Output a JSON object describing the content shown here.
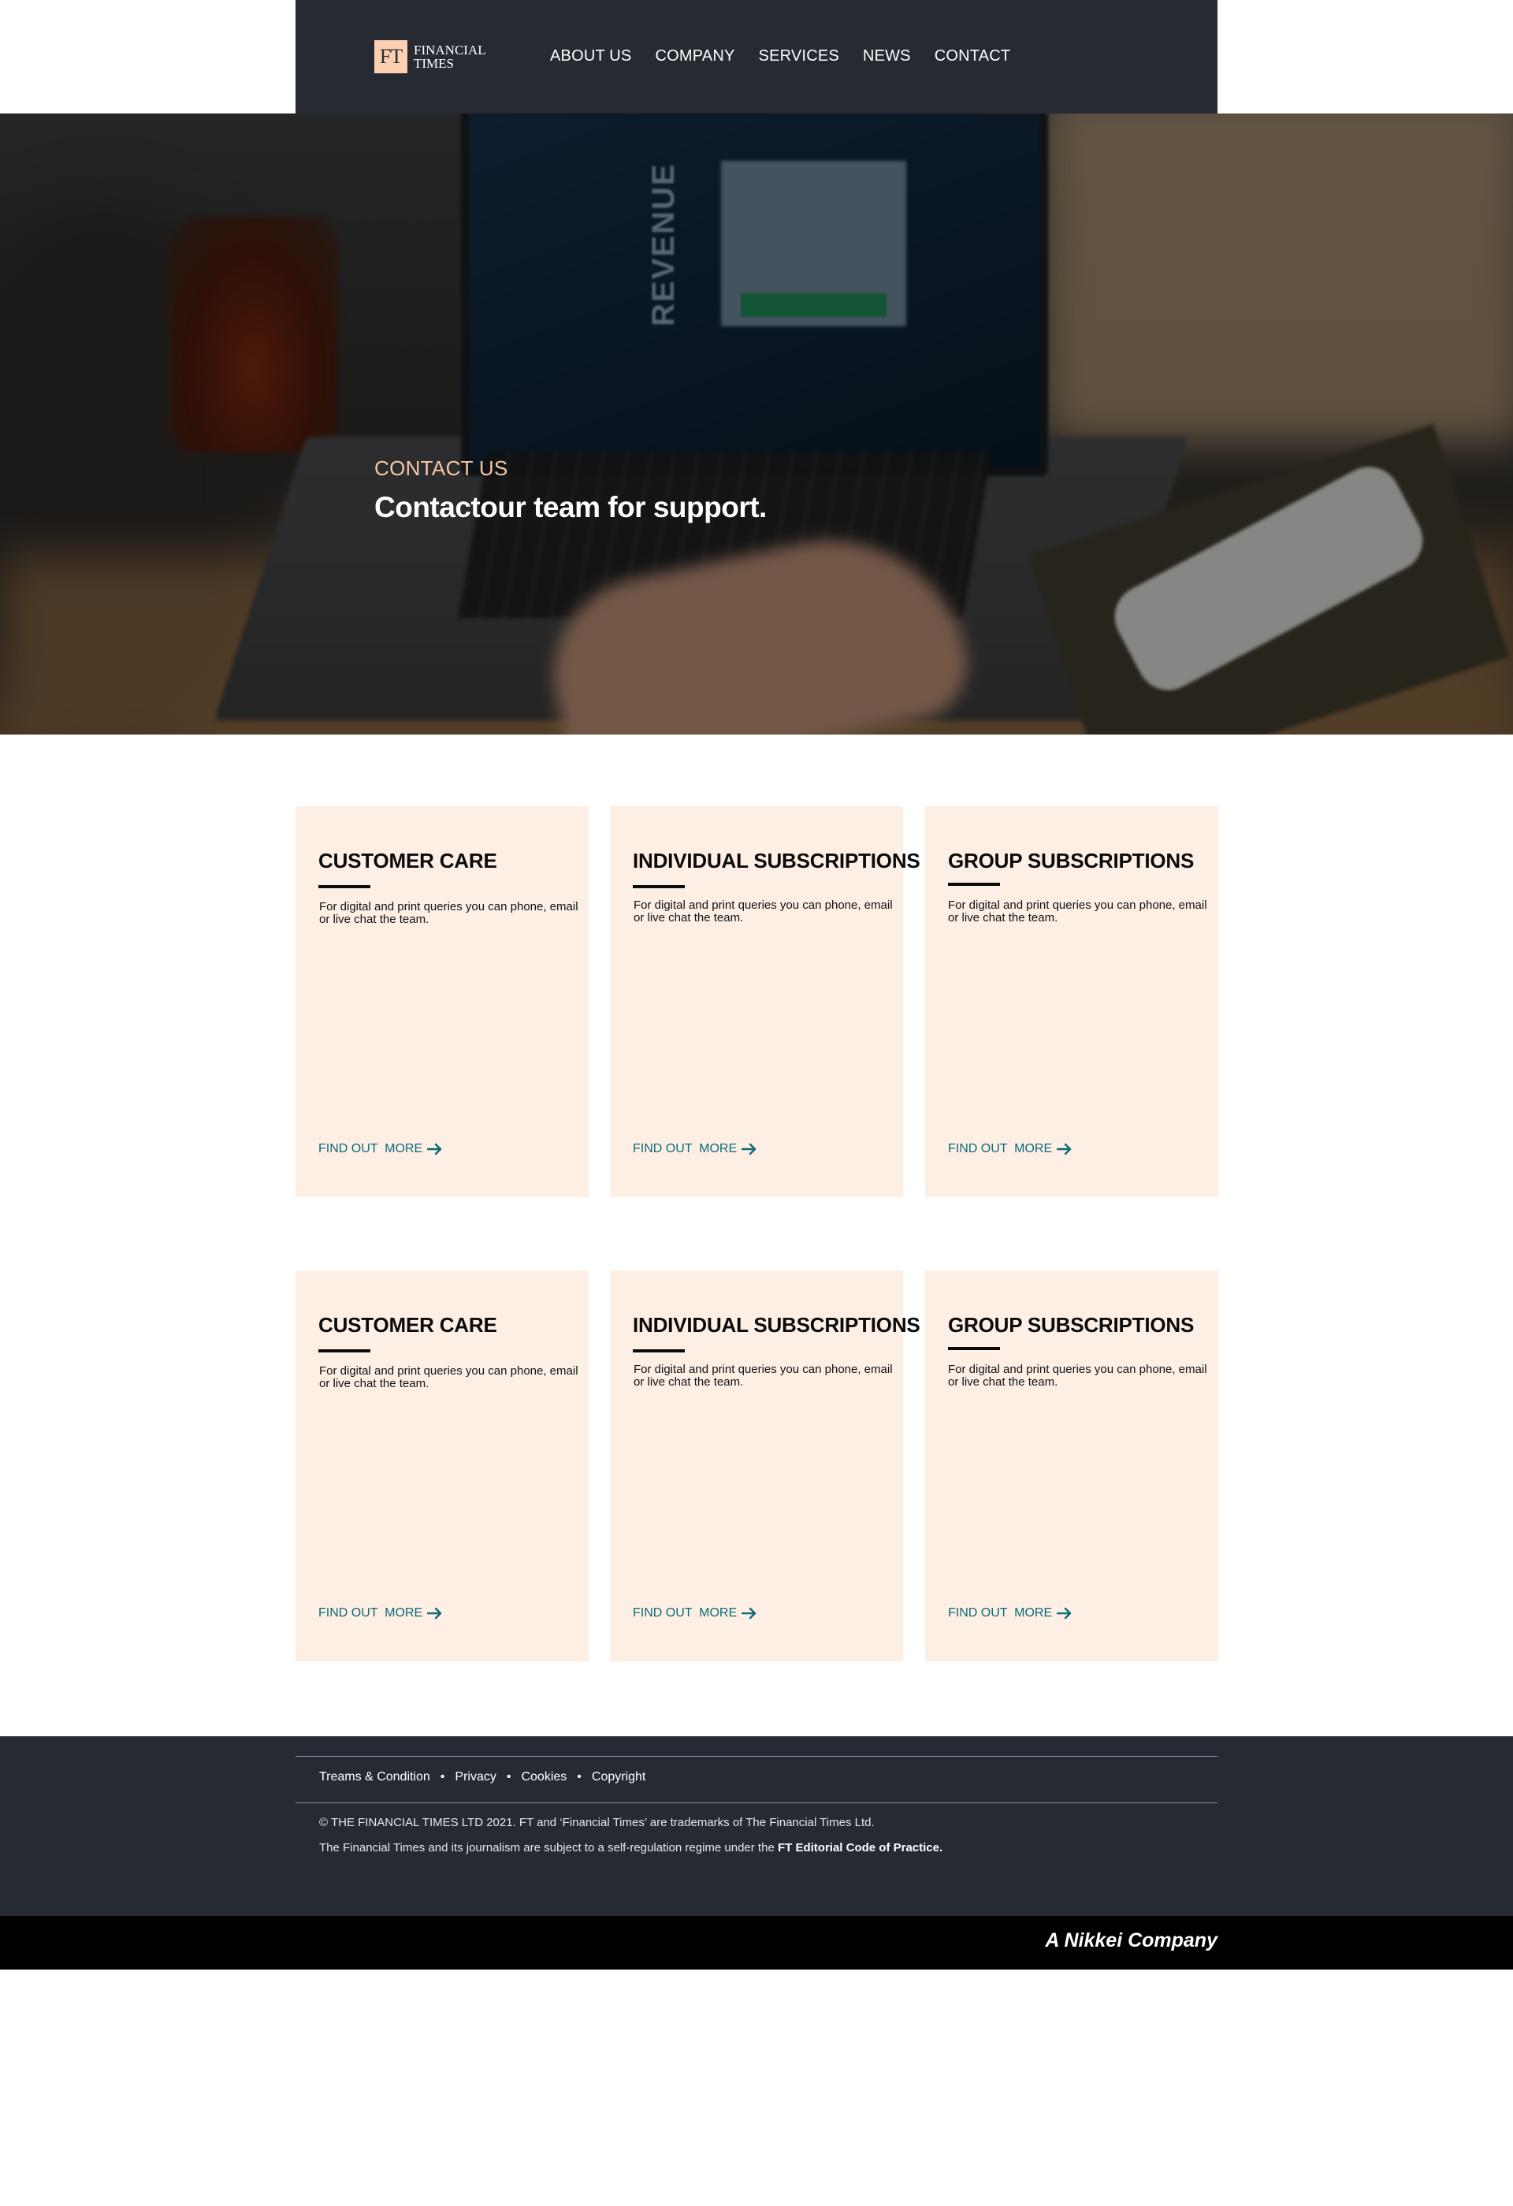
{
  "brand": {
    "logo_mark": "FT",
    "logo_line1": "FINANCIAL",
    "logo_line2": "TIMES"
  },
  "nav": {
    "items": [
      "ABOUT US",
      "COMPANY",
      "SERVICES",
      "NEWS",
      "CONTACT"
    ]
  },
  "hero": {
    "kicker": "CONTACT US",
    "title": "Contactour team for support.",
    "image_text": "REVENUE"
  },
  "cards": [
    {
      "title": "CUSTOMER CARE",
      "body": "For digital and print queries you can phone, email or live chat the team.",
      "link": "FIND OUT  MORE"
    },
    {
      "title": "INDIVIDUAL SUBSCRIPTIONS",
      "body": "For digital and print queries you can phone, email or live chat the team.",
      "link": "FIND OUT  MORE"
    },
    {
      "title": "GROUP SUBSCRIPTIONS",
      "body": "For digital and print queries you can phone, email or live chat the team.",
      "link": "FIND OUT  MORE"
    },
    {
      "title": "CUSTOMER CARE",
      "body": "For digital and print queries you can phone, email or live chat the team.",
      "link": "FIND OUT  MORE"
    },
    {
      "title": "INDIVIDUAL SUBSCRIPTIONS",
      "body": "For digital and print queries you can phone, email or live chat the team.",
      "link": "FIND OUT  MORE"
    },
    {
      "title": "GROUP SUBSCRIPTIONS",
      "body": "For digital and print queries you can phone, email or live chat the team.",
      "link": "FIND OUT  MORE"
    }
  ],
  "footer": {
    "links": [
      "Treams & Condition",
      "Privacy",
      "Cookies",
      "Copyright"
    ],
    "copyright": "© THE FINANCIAL TIMES LTD 2021. FT and ‘Financial Times’ are trademarks of The Financial Times Ltd.",
    "regulation_prefix": "The Financial Times and its journalism are subject to a self-regulation regime under the ",
    "regulation_link": "FT Editorial Code of Practice.",
    "company": "A Nikkei Company"
  },
  "colors": {
    "header_bg": "#262a33",
    "accent_peach": "#fcd0b1",
    "card_bg": "#fdefe4",
    "link_teal": "#0d6a7a"
  }
}
